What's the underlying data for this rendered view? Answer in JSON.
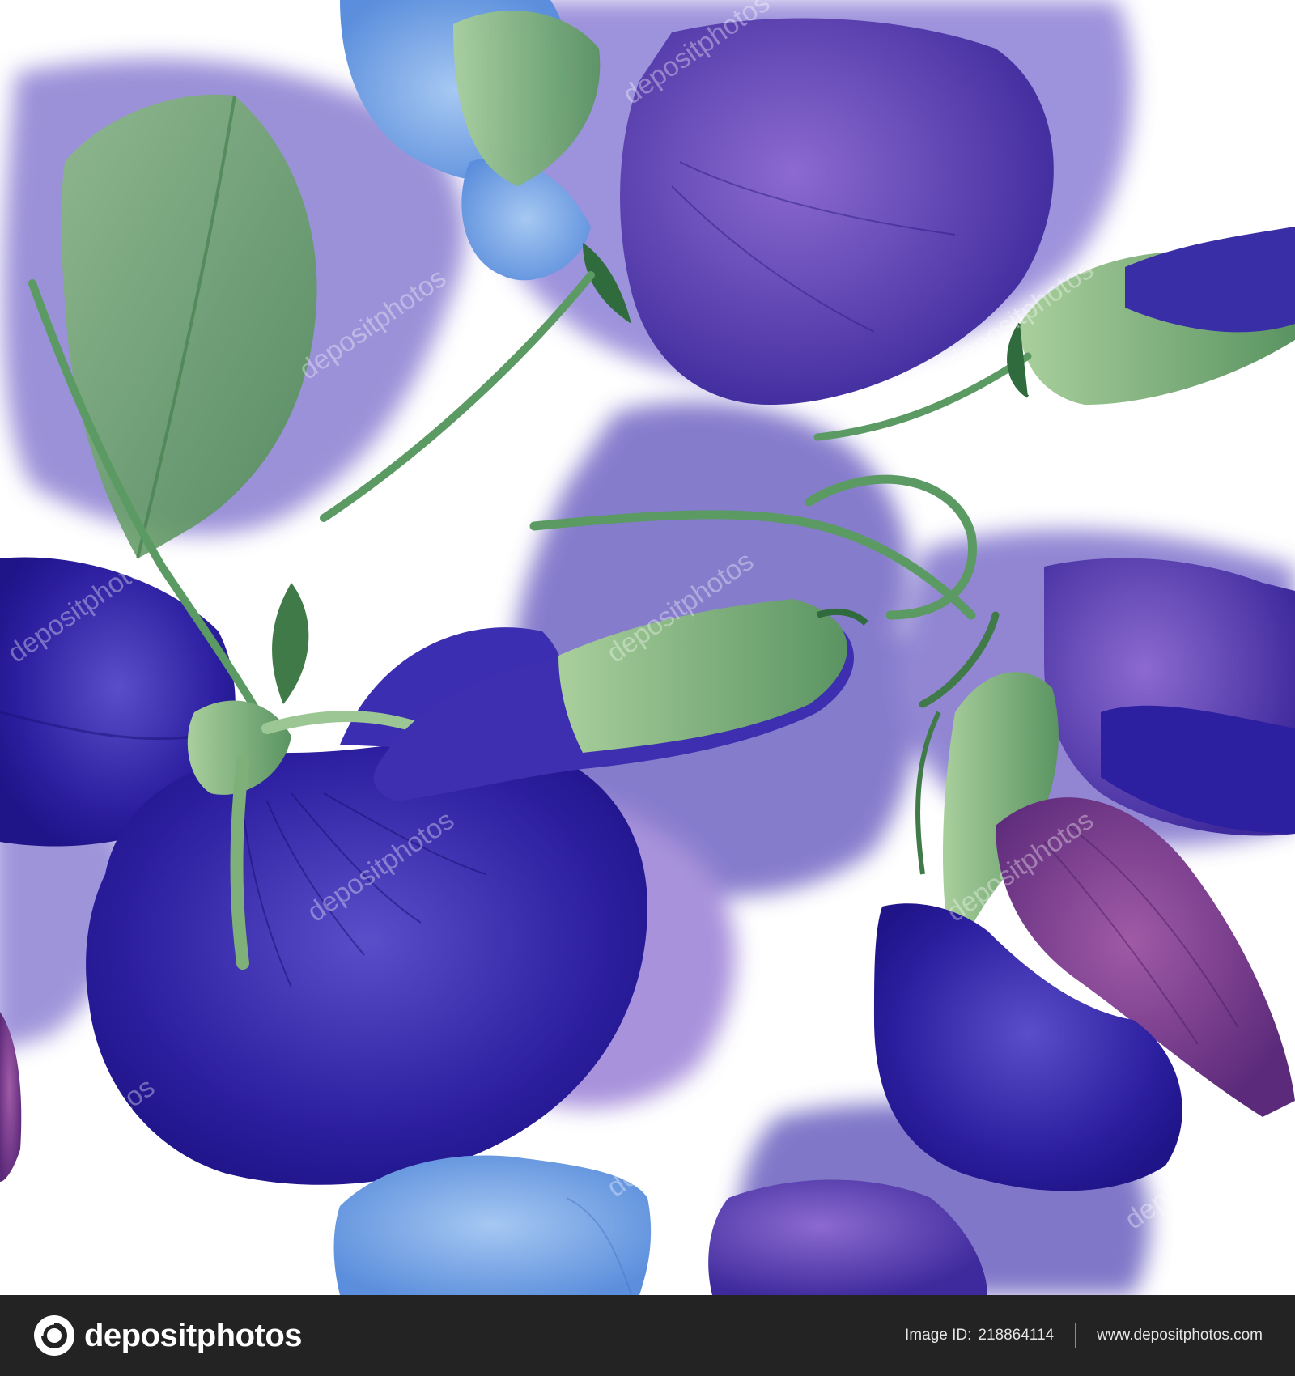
{
  "image": {
    "watermark_text": "depositphotos"
  },
  "footer": {
    "brand": "depositphotos",
    "image_id_label": "Image ID:",
    "image_id": "218864114",
    "site_url": "www.depositphotos.com"
  },
  "colors": {
    "violet_wash": "#7a6ac8",
    "deep_blue": "#2c1fa0",
    "light_blue": "#6f9ee0",
    "leaf_green": "#6e9f6a",
    "plum": "#7a3a8a",
    "footer_bg": "#232323"
  }
}
